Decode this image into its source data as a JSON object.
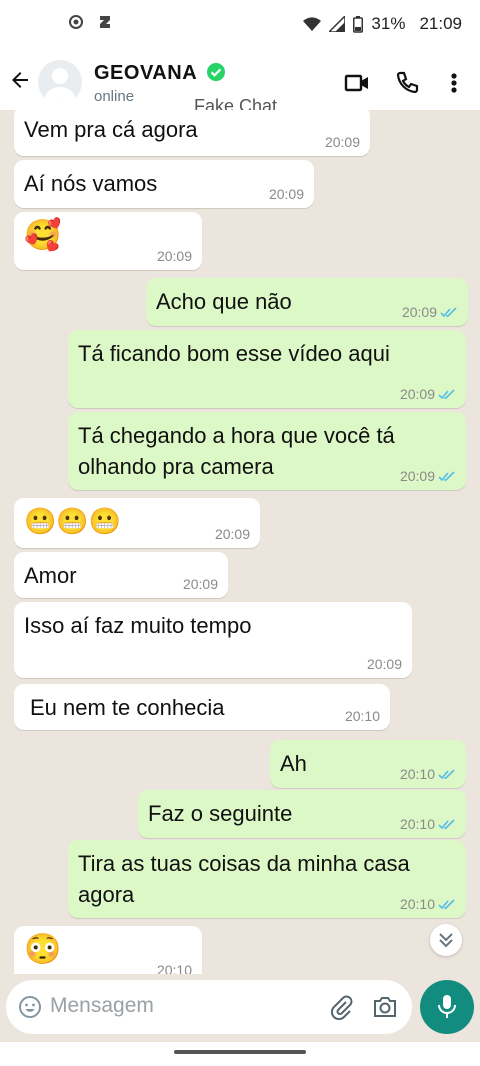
{
  "statusbar": {
    "battery": "31%",
    "time": "21:09"
  },
  "header": {
    "contact_name": "GEOVANA",
    "status": "online",
    "overlay_label": "Fake Chat"
  },
  "messages": [
    {
      "dir": "in",
      "text": "Vem pra cá agora",
      "time": "20:09"
    },
    {
      "dir": "in",
      "text": "Aí nós vamos",
      "time": "20:09"
    },
    {
      "dir": "in",
      "text": "🥰",
      "time": "20:09"
    },
    {
      "dir": "out",
      "text": "Acho que não",
      "time": "20:09"
    },
    {
      "dir": "out",
      "text": "Tá ficando bom esse vídeo aqui",
      "time": "20:09"
    },
    {
      "dir": "out",
      "text": "Tá chegando a hora que você tá\nolhando pra camera",
      "time": "20:09"
    },
    {
      "dir": "in",
      "text": "😬😬😬",
      "time": "20:09"
    },
    {
      "dir": "in",
      "text": "Amor",
      "time": "20:09"
    },
    {
      "dir": "in",
      "text": "Isso aí faz muito tempo",
      "time": "20:09"
    },
    {
      "dir": "in",
      "text": "Eu nem te conhecia",
      "time": "20:10"
    },
    {
      "dir": "out",
      "text": "Ah",
      "time": "20:10"
    },
    {
      "dir": "out",
      "text": "Faz o seguinte",
      "time": "20:10"
    },
    {
      "dir": "out",
      "text": "Tira as tuas coisas da minha casa\nagora",
      "time": "20:10"
    },
    {
      "dir": "in",
      "text": "😳",
      "time": "20:10"
    }
  ],
  "composer": {
    "placeholder": "Mensagem"
  },
  "colors": {
    "accent": "#128c7e",
    "outgoing": "#dcf8c6",
    "incoming": "#ffffff",
    "verified": "#25d366",
    "read_ticks": "#53bdeb"
  }
}
